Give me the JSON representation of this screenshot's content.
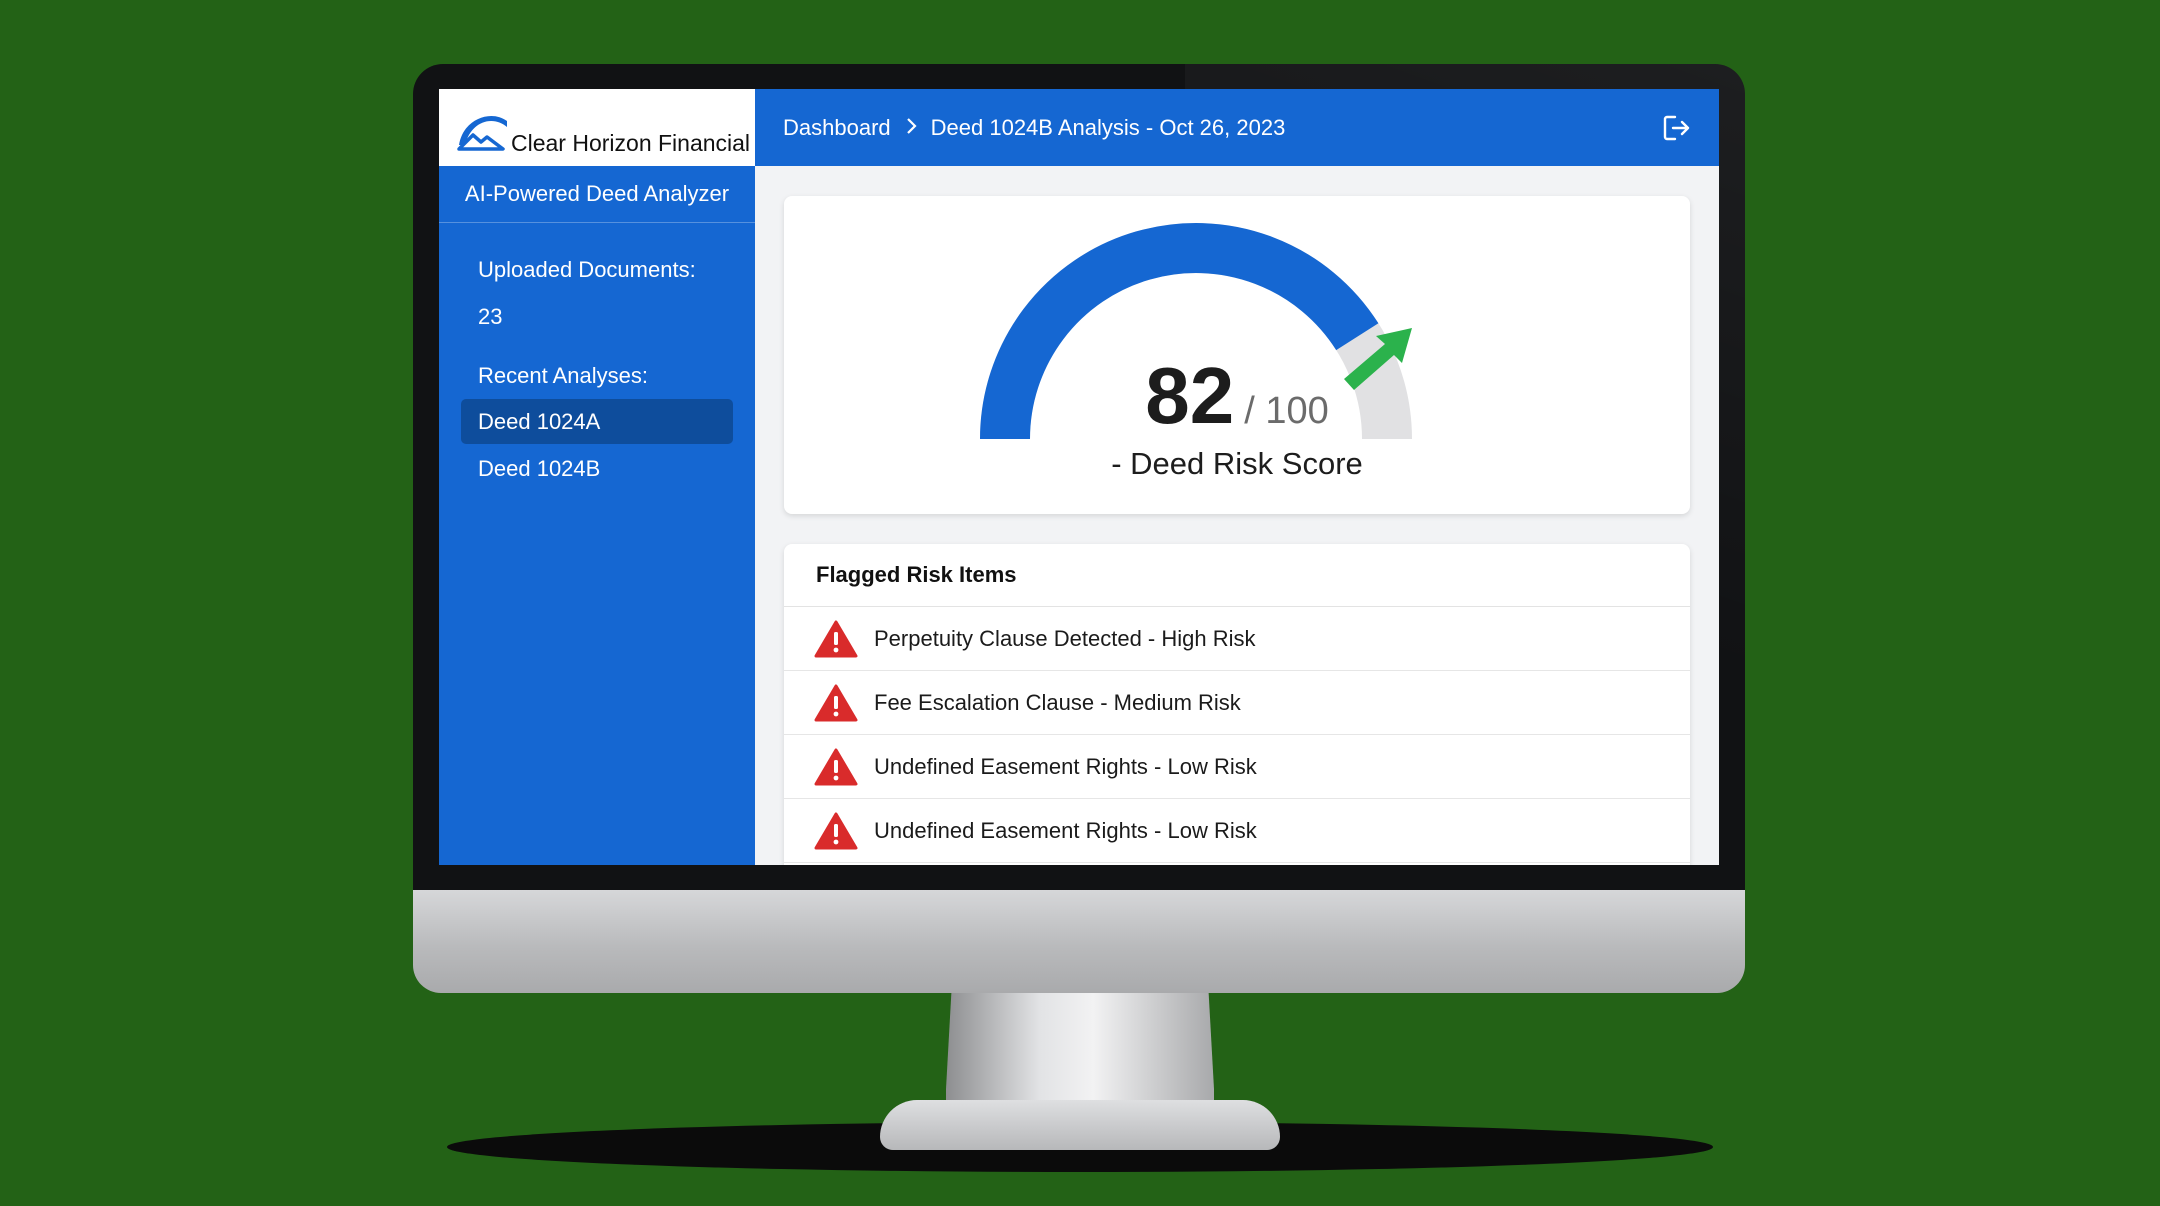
{
  "brand": {
    "name": "Clear Horizon Financial",
    "app_title": "AI-Powered Deed Analyzer"
  },
  "sidebar": {
    "uploaded_label": "Uploaded Documents:",
    "uploaded_count": "23",
    "recent_label": "Recent Analyses:",
    "items": [
      {
        "label": "Deed 1024A",
        "active": true
      },
      {
        "label": "Deed 1024B",
        "active": false
      }
    ]
  },
  "header": {
    "breadcrumb": [
      "Dashboard",
      "Deed 1024B Analysis - Oct 26, 2023"
    ],
    "separator": ">",
    "exit_icon": "logout-icon"
  },
  "gauge": {
    "score": "82",
    "max": "/ 100",
    "label": "- Deed Risk Score",
    "fill_fraction": 0.82,
    "colors": {
      "fill": "#1567d2",
      "track": "#e1e1e3",
      "arrow": "#2bb24c"
    }
  },
  "flagged": {
    "title": "Flagged Risk Items",
    "items": [
      "Perpetuity Clause Detected - High Risk",
      "Fee Escalation Clause - Medium Risk",
      "Undefined Easement Rights - Low Risk",
      "Undefined Easement Rights - Low Risk"
    ],
    "icon": "warning-triangle-icon",
    "icon_color": "#d92b2b"
  },
  "colors": {
    "primary": "#1567d2",
    "primary_dark": "#0e4d9c",
    "background": "#236216"
  }
}
